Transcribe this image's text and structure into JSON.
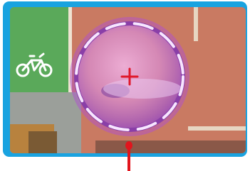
{
  "colors": {
    "frame_border": "#19a3e0",
    "road": "#c97a62",
    "bike_lane": "#5aa95a",
    "lens_tint": "#d88ccc",
    "lens_ring_dash": "#f7e6ff",
    "lens_glow": "#b04fd0",
    "crosshair": "#e0172a",
    "cursor_pointer": "#e2141c"
  },
  "icons": {
    "bicycle": "bicycle-lane-icon",
    "crosshair": "crosshair-icon",
    "pointer": "stylus-pointer-icon"
  }
}
